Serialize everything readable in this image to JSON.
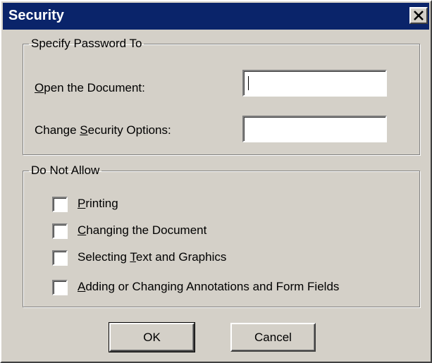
{
  "window": {
    "title": "Security",
    "close_icon": "close-icon"
  },
  "password_group": {
    "legend": "Specify Password To",
    "open_label_mnemonic": "O",
    "open_label_rest": "pen the Document:",
    "open_value": "",
    "change_label_prefix": "Change ",
    "change_label_mnemonic": "S",
    "change_label_rest": "ecurity Options:",
    "change_value": ""
  },
  "restrictions_group": {
    "legend": "Do Not Allow",
    "items": [
      {
        "mnemonic": "P",
        "rest": "rinting",
        "prefix": "",
        "checked": false
      },
      {
        "mnemonic": "C",
        "rest": "hanging the Document",
        "prefix": "",
        "checked": false
      },
      {
        "mnemonic": "T",
        "rest": "ext and Graphics",
        "prefix": "Selecting ",
        "checked": false
      },
      {
        "mnemonic": "A",
        "rest": "dding or Changing Annotations and Form Fields",
        "prefix": "",
        "checked": false
      }
    ]
  },
  "buttons": {
    "ok": "OK",
    "cancel": "Cancel"
  }
}
